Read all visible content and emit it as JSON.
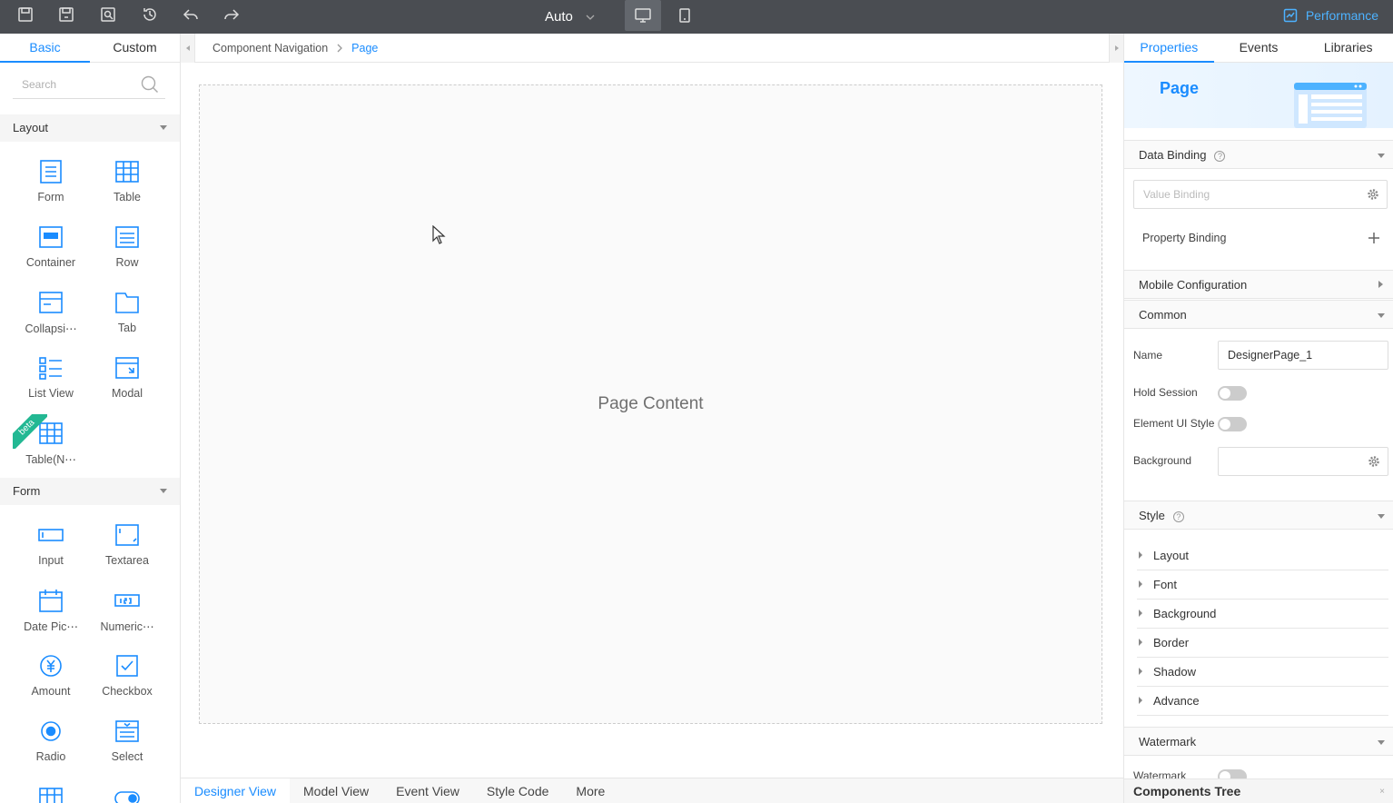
{
  "toolbar": {
    "zoom_mode": "Auto",
    "performance_label": "Performance",
    "accent": "#1a8cff",
    "bg": "#4a4d52"
  },
  "left_panel": {
    "tabs": [
      {
        "label": "Basic"
      },
      {
        "label": "Custom"
      }
    ],
    "search_placeholder": "Search",
    "sections": [
      {
        "title": "Layout",
        "items": [
          {
            "label": "Form",
            "icon": "form-icon"
          },
          {
            "label": "Table",
            "icon": "table-icon"
          },
          {
            "label": "Container",
            "icon": "container-icon"
          },
          {
            "label": "Row",
            "icon": "row-icon"
          },
          {
            "label": "Collapsi⋯",
            "icon": "collapse-icon"
          },
          {
            "label": "Tab",
            "icon": "tab-icon"
          },
          {
            "label": "List View",
            "icon": "list-view-icon"
          },
          {
            "label": "Modal",
            "icon": "modal-icon"
          },
          {
            "label": "Table(N⋯",
            "icon": "table-new-icon",
            "badge": "beta"
          }
        ]
      },
      {
        "title": "Form",
        "items": [
          {
            "label": "Input",
            "icon": "input-icon"
          },
          {
            "label": "Textarea",
            "icon": "textarea-icon"
          },
          {
            "label": "Date Pic⋯",
            "icon": "date-picker-icon"
          },
          {
            "label": "Numeric⋯",
            "icon": "numeric-icon"
          },
          {
            "label": "Amount",
            "icon": "amount-icon"
          },
          {
            "label": "Checkbox",
            "icon": "checkbox-icon"
          },
          {
            "label": "Radio",
            "icon": "radio-icon"
          },
          {
            "label": "Select",
            "icon": "select-icon"
          }
        ]
      }
    ]
  },
  "center": {
    "breadcrumb": {
      "root": "Component Navigation",
      "current": "Page"
    },
    "canvas_label": "Page Content",
    "bottom_tabs": [
      {
        "label": "Designer View"
      },
      {
        "label": "Model View"
      },
      {
        "label": "Event View"
      },
      {
        "label": "Style Code"
      },
      {
        "label": "More"
      }
    ]
  },
  "right_panel": {
    "tabs": [
      {
        "label": "Properties"
      },
      {
        "label": "Events"
      },
      {
        "label": "Libraries"
      }
    ],
    "page_title": "Page",
    "data_binding": {
      "title": "Data Binding",
      "value_binding_placeholder": "Value Binding",
      "property_binding": "Property Binding"
    },
    "mobile_configuration": "Mobile Configuration",
    "common": {
      "title": "Common",
      "name_label": "Name",
      "name_value": "DesignerPage_1",
      "hold_session_label": "Hold Session",
      "element_ui_style_label": "Element UI Style",
      "background_label": "Background"
    },
    "style": {
      "title": "Style",
      "items": [
        {
          "label": "Layout"
        },
        {
          "label": "Font"
        },
        {
          "label": "Background"
        },
        {
          "label": "Border"
        },
        {
          "label": "Shadow"
        },
        {
          "label": "Advance"
        }
      ]
    },
    "watermark": {
      "title": "Watermark",
      "label": "Watermark"
    },
    "components_tree": "Components Tree",
    "components_tree_close": "×"
  }
}
